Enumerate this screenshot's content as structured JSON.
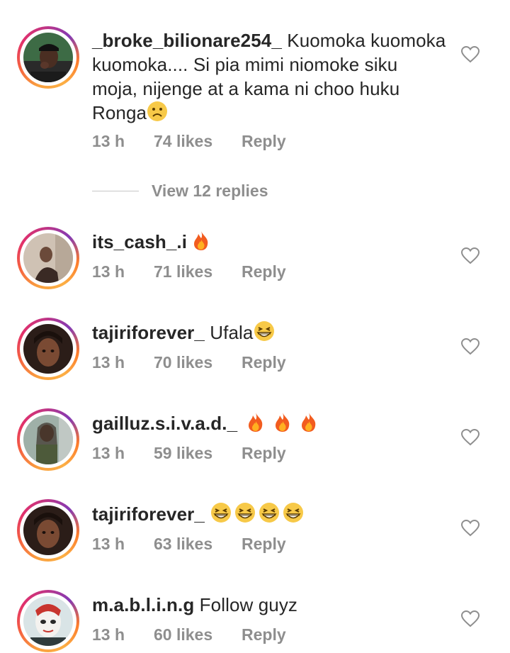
{
  "view_replies_label": "View 12 replies",
  "comments": [
    {
      "username": "_broke_bilionare254_",
      "text": "Kuomoka kuomoka kuomoka.... Si pia mimi niomoke siku moja, nijenge at a kama ni choo huku Ronga",
      "emoji": "sad-face",
      "time": "13 h",
      "likes": "74 likes",
      "reply": "Reply"
    },
    {
      "username": "its_cash_.i",
      "text": "",
      "emoji": "fire",
      "time": "13 h",
      "likes": "71 likes",
      "reply": "Reply"
    },
    {
      "username": "tajiriforever_",
      "text": "Ufala",
      "emoji": "grinning-squint",
      "time": "13 h",
      "likes": "70 likes",
      "reply": "Reply"
    },
    {
      "username": "gailluz.s.i.v.a.d._",
      "text": "",
      "emoji": "fire x3",
      "time": "13 h",
      "likes": "59 likes",
      "reply": "Reply"
    },
    {
      "username": "tajiriforever_",
      "text": "",
      "emoji": "grinning-squint x4",
      "time": "13 h",
      "likes": "63 likes",
      "reply": "Reply"
    },
    {
      "username": "m.a.b.l.i.n.g",
      "text": "Follow guyz",
      "emoji": "",
      "time": "13 h",
      "likes": "60 likes",
      "reply": "Reply"
    }
  ],
  "colors": {
    "text": "#262626",
    "muted": "#8e8e8e",
    "ring_start": "#f9a03f",
    "ring_end": "#c13584"
  }
}
